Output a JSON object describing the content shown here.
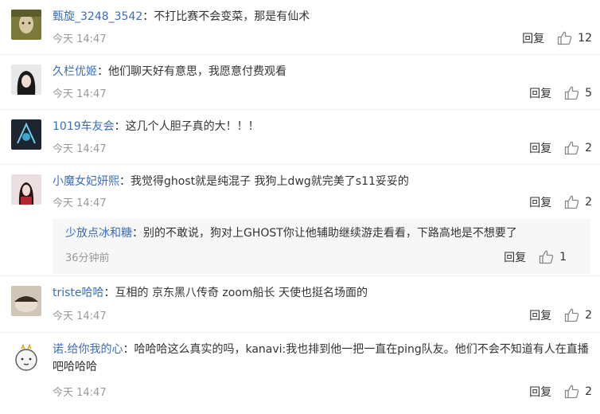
{
  "comments": [
    {
      "user": "甄旋_3248_3542",
      "text": "不打比赛不会变菜，那是有仙术",
      "time": "今天 14:47",
      "reply": "回复",
      "likes": "12"
    },
    {
      "user": "久栏优姬",
      "text": "他们聊天好有意思，我愿意付费观看",
      "time": "今天 14:47",
      "reply": "回复",
      "likes": "5"
    },
    {
      "user": "1019车友会",
      "text": "这几个人胆子真的大！！！",
      "time": "今天 14:47",
      "reply": "回复",
      "likes": "2"
    },
    {
      "user": "小魔女妃妍熙",
      "text": "我觉得ghost就是纯混子 我狗上dwg就完美了s11妥妥的",
      "time": "今天 14:47",
      "reply": "回复",
      "likes": "2",
      "sub_reply": {
        "user": "少放点冰和糖",
        "text": "别的不敢说，狗对上GHOST你让他辅助继续游走看看，下路高地是不想要了",
        "time": "36分钟前",
        "reply": "回复",
        "likes": "1"
      }
    },
    {
      "user": "triste哈哈",
      "text": "互相的 京东黑八传奇 zoom船长 天使也挺名场面的",
      "time": "今天 14:47",
      "reply": "回复",
      "likes": "2"
    },
    {
      "user": "诺.给你我的心",
      "text": "哈哈哈这么真实的吗，kanavi:我也排到他一把一直在ping队友。他们不会不知道有人在直播吧哈哈哈",
      "time": "今天 14:47",
      "reply": "回复",
      "likes": "2"
    }
  ],
  "separator": "：",
  "icons": {
    "like": "thumbs-up-icon"
  },
  "colors": {
    "username": "#3b6db3",
    "time": "#999999",
    "sub_bg": "#f7f7f7"
  }
}
